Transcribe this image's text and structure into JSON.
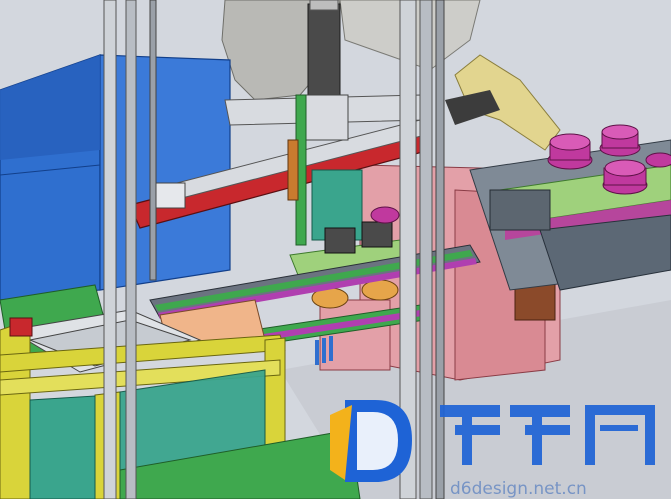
{
  "scene": {
    "description_type": "3d-cad-assembly-render"
  },
  "watermark": {
    "url_text": "d6design.net.cn",
    "logo_color": "#1e63d6",
    "logo_accent": "#f3b21b"
  },
  "colors": {
    "background": "#d3d7de",
    "blue_box": "#2f6fcf",
    "red_beam": "#c8282d",
    "pink_part": "#e3a0a8",
    "magenta_cup": "#c0399e",
    "green_plate": "#9fd17c",
    "yellow_frame": "#d9d43a",
    "teal_block": "#3aa58d",
    "frame_post": "#cfd3d8"
  }
}
